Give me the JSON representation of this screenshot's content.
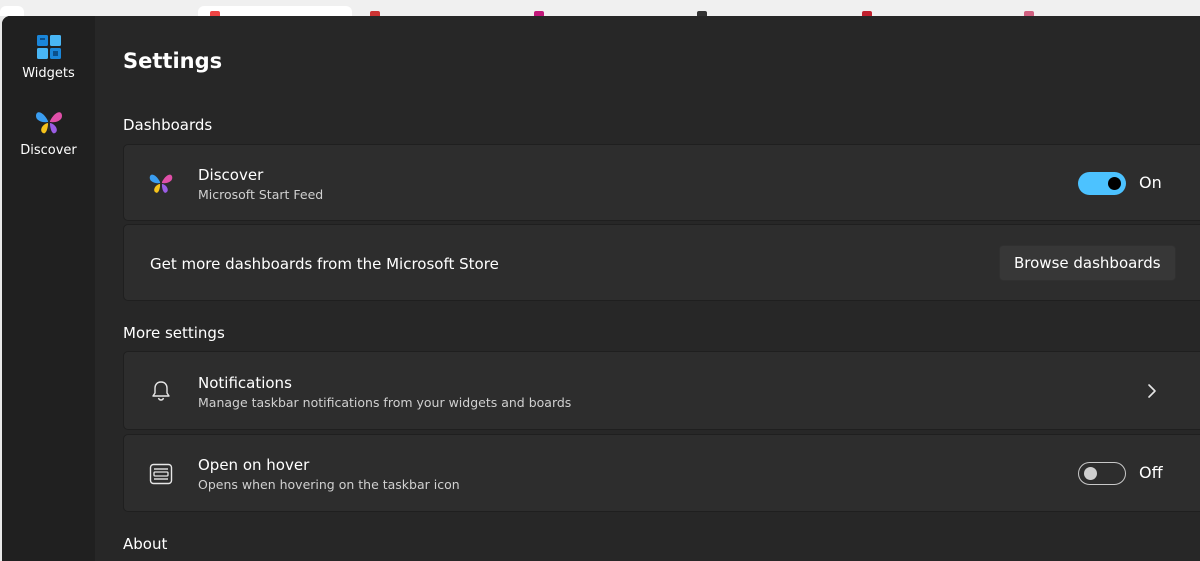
{
  "window": {
    "title": "Settings"
  },
  "nav": {
    "items": [
      {
        "label": "Widgets",
        "icon": "widgets-icon"
      },
      {
        "label": "Discover",
        "icon": "discover-butterfly-icon"
      }
    ]
  },
  "sections": {
    "dashboards": {
      "title": "Dashboards",
      "discover": {
        "title": "Discover",
        "subtitle": "Microsoft Start Feed",
        "toggle_state": "On",
        "toggle_on": true
      },
      "store": {
        "text": "Get more dashboards from the Microsoft Store",
        "button_label": "Browse dashboards"
      }
    },
    "more_settings": {
      "title": "More settings",
      "notifications": {
        "title": "Notifications",
        "subtitle": "Manage taskbar notifications from your widgets and boards",
        "icon": "bell-icon"
      },
      "open_on_hover": {
        "title": "Open on hover",
        "subtitle": "Opens when hovering on the taskbar icon",
        "toggle_state": "Off",
        "toggle_on": false,
        "icon": "taskbar-panel-icon"
      }
    },
    "about": {
      "title": "About"
    }
  },
  "colors": {
    "accent": "#4cc2ff",
    "window_bg": "#272727",
    "nav_bg": "#202020",
    "card_bg": "#2d2d2d"
  }
}
